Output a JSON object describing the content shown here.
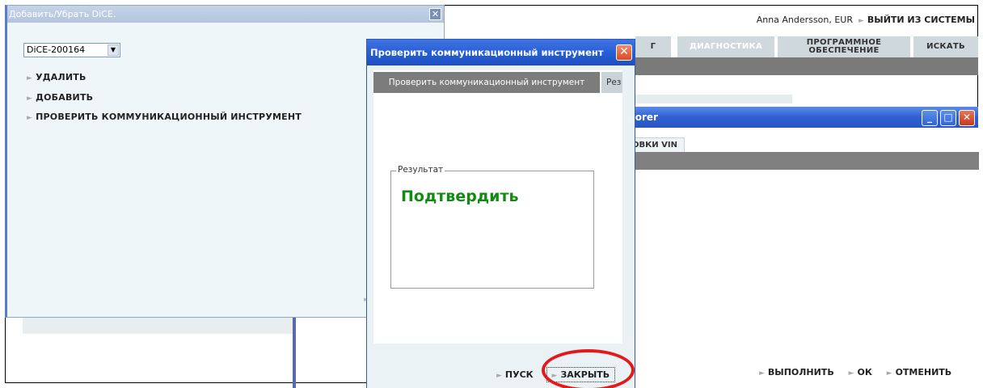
{
  "header": {
    "user": "Anna Andersson, EUR",
    "logout_label": "ВЫЙТИ ИЗ СИСТЕМЫ"
  },
  "nav_tabs": {
    "partial": "Г",
    "diagnostics": "ДИАГНОСТИКА",
    "software": "ПРОГРАММНОЕ ОБЕСПЕЧЕНИЕ",
    "search": "ИСКАТЬ"
  },
  "explorer": {
    "title": "plorer",
    "tab_label": "ОВКИ VIN",
    "actions": [
      "ВЫПОЛНИТЬ",
      "ОК",
      "ОТМЕНИТЬ"
    ]
  },
  "dice_window": {
    "title": "Добавить/Убрать DiCE.",
    "selected_device": "DiCE-200164",
    "items": [
      "УДАЛИТЬ",
      "ДОБАВИТЬ",
      "ПРОВЕРИТЬ КОММУНИКАЦИОННЫЙ ИНСТРУМЕНТ"
    ]
  },
  "check_dialog": {
    "title": "Проверить коммуникационный инструмент",
    "tab_active": "Проверить коммуникационный инструмент",
    "tab_next": "Рез",
    "group_label": "Результат",
    "result_text": "Подтвердить",
    "start_label": "ПУСК",
    "close_label": "ЗАКРЫТЬ"
  },
  "colors": {
    "accent_blue": "#245bd4",
    "result_green": "#138a13",
    "highlight_red": "#e21a1a"
  }
}
